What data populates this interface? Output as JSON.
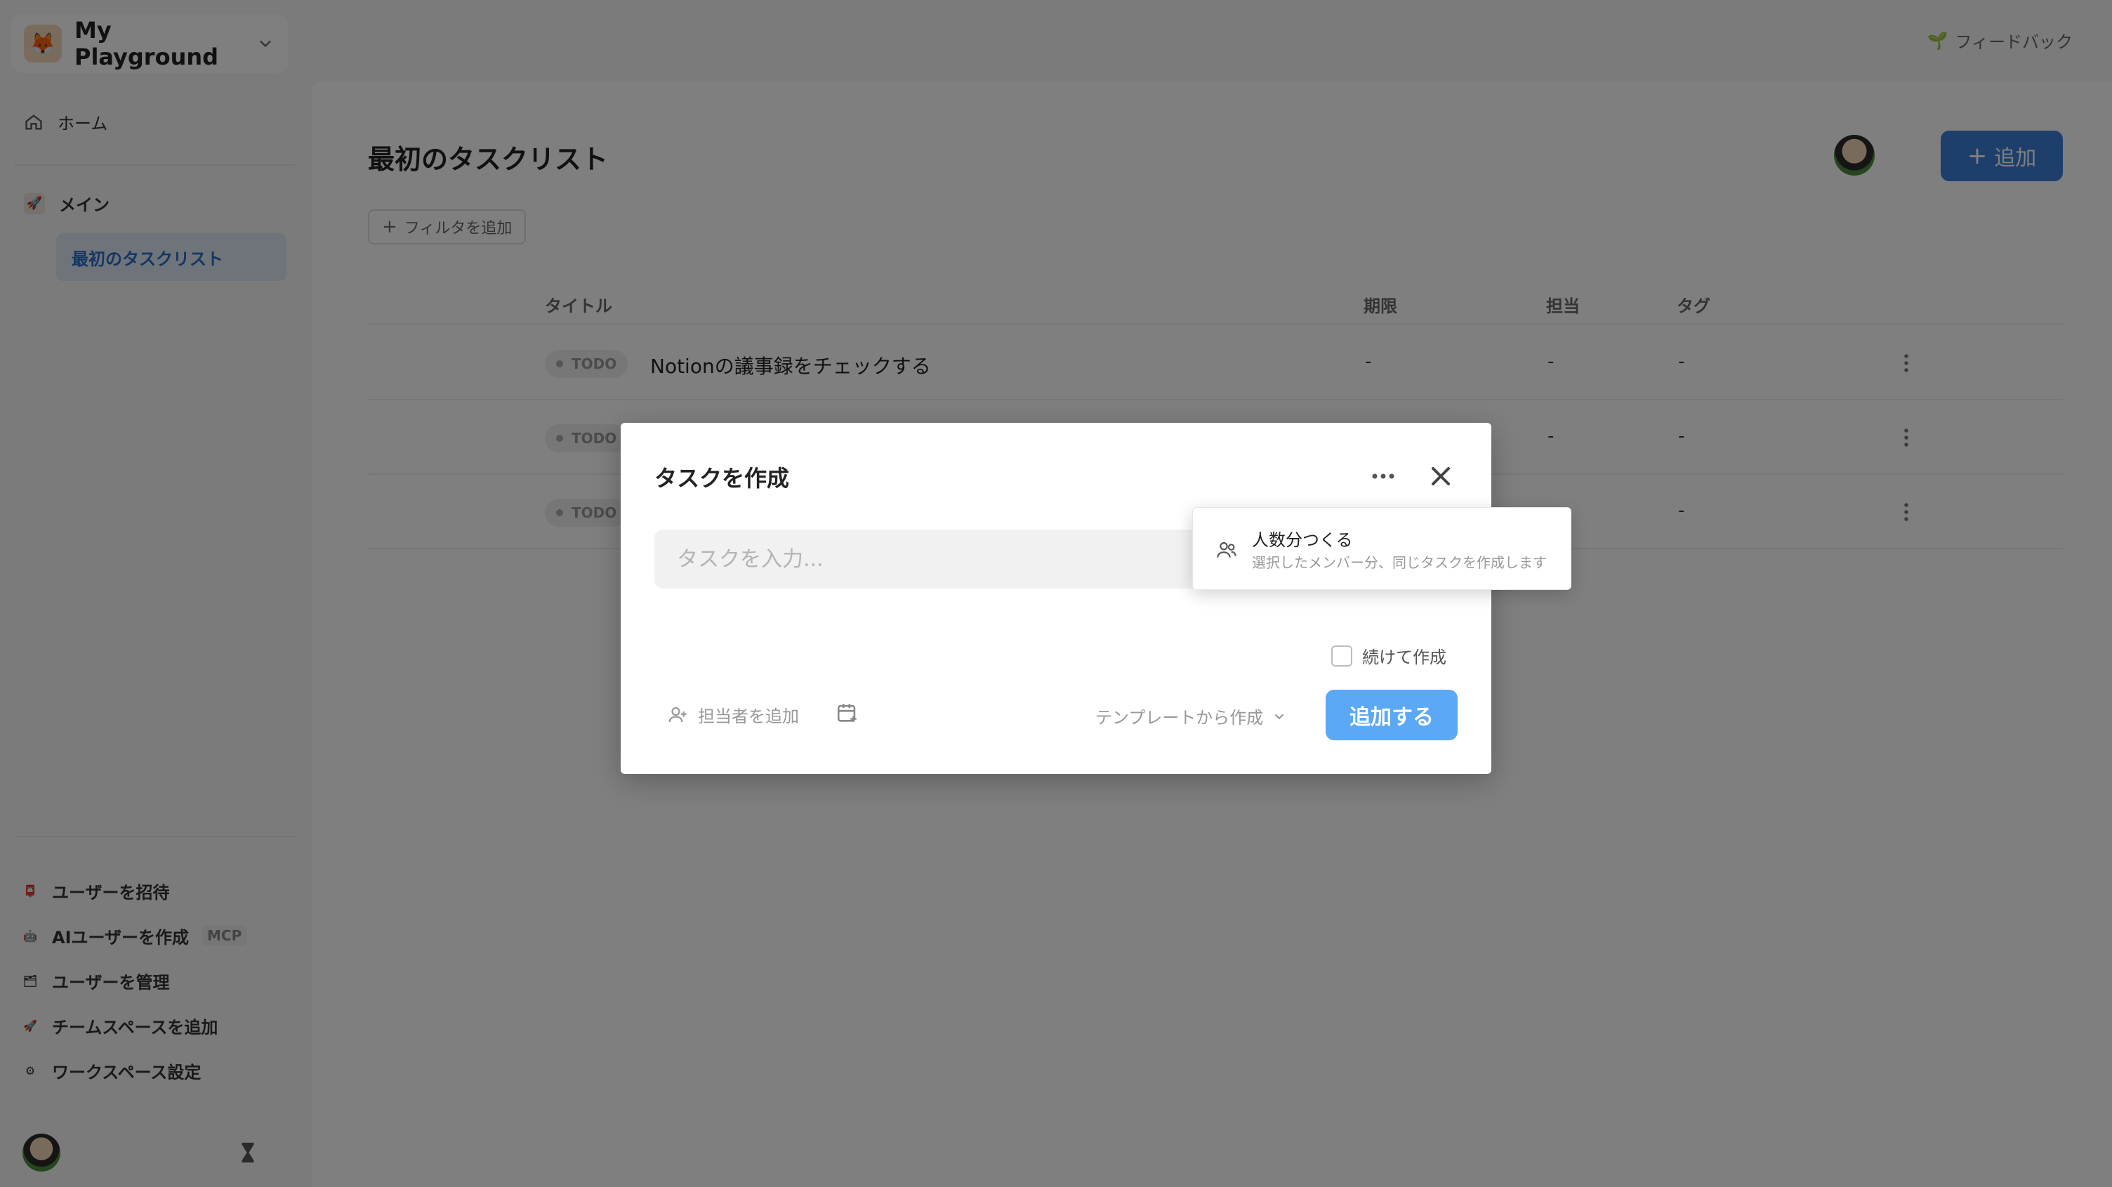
{
  "workspace": {
    "name": "My Playground",
    "logo_icon": "fox-icon"
  },
  "sidebar": {
    "home_label": "ホーム",
    "section_label": "メイン",
    "section_emoji": "🚀",
    "active_list_label": "最初のタスクリスト",
    "bottom_items": [
      {
        "label": "ユーザーを招待",
        "icon": "📮"
      },
      {
        "label": "AIユーザーを作成",
        "icon": "🤖",
        "badge": "MCP"
      },
      {
        "label": "ユーザーを管理",
        "icon": "🗂"
      },
      {
        "label": "チームスペースを追加",
        "icon": "🚀"
      },
      {
        "label": "ワークスペース設定",
        "icon": "⚙"
      }
    ]
  },
  "header": {
    "feedback_label": "フィードバック",
    "feedback_icon": "🌱"
  },
  "main": {
    "title": "最初のタスクリスト",
    "filter_label": "フィルタを追加",
    "add_label": "追加",
    "columns": {
      "title": "タイトル",
      "due": "期限",
      "assignee": "担当",
      "tag": "タグ"
    },
    "rows": [
      {
        "status": "TODO",
        "title": "Notionの議事録をチェックする",
        "due": "-",
        "assignee": "-",
        "tag": "-"
      },
      {
        "status": "TODO",
        "title": "",
        "due": "-",
        "assignee": "-",
        "tag": "-"
      },
      {
        "status": "TODO",
        "title": "",
        "due": "",
        "assignee": "",
        "tag": "-"
      }
    ]
  },
  "modal": {
    "title": "タスクを作成",
    "input_placeholder": "タスクを入力...",
    "continue_label": "続けて作成",
    "assignee_label": "担当者を追加",
    "template_label": "テンプレートから作成",
    "submit_label": "追加する"
  },
  "dropdown": {
    "item_title": "人数分つくる",
    "item_desc": "選択したメンバー分、同じタスクを作成します"
  },
  "colors": {
    "accent": "#3c7ed6",
    "submit": "#5aa8f6",
    "active_nav": "#2b6cc4"
  }
}
